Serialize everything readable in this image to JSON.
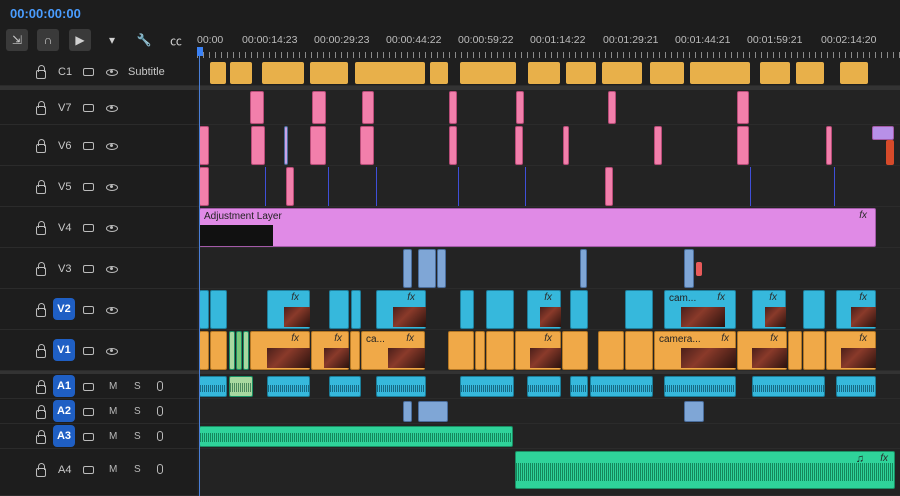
{
  "timecode": "00:00:00:00",
  "ruler": [
    "00:00",
    "00:00:14:23",
    "00:00:29:23",
    "00:00:44:22",
    "00:00:59:22",
    "00:01:14:22",
    "00:01:29:21",
    "00:01:44:21",
    "00:01:59:21",
    "00:02:14:20"
  ],
  "tools": [
    "insert-and-overwrite-icon",
    "snap-icon",
    "linked-selection-icon",
    "add-marker-icon",
    "settings-icon",
    "captions-icon"
  ],
  "tracks": {
    "c1": {
      "name": "C1",
      "label": "Subtitle"
    },
    "v7": {
      "name": "V7"
    },
    "v6": {
      "name": "V6"
    },
    "v5": {
      "name": "V5"
    },
    "v4": {
      "name": "V4"
    },
    "v3": {
      "name": "V3"
    },
    "v2": {
      "name": "V2"
    },
    "v1": {
      "name": "V1"
    },
    "a1": {
      "name": "A1"
    },
    "a2": {
      "name": "A2"
    },
    "a3": {
      "name": "A3"
    },
    "a4": {
      "name": "A4"
    }
  },
  "buttons": {
    "mute": "M",
    "solo": "S"
  },
  "clips": {
    "adjustment": "Adjustment Layer",
    "fx": "fx",
    "v1_ca": "ca...",
    "v1_camera": "camera...",
    "v2_cam": "cam..."
  },
  "colors": {
    "accent": "#4a9dff",
    "subtitle": "#e8b04a",
    "graphics": "#f27fab",
    "video_blue": "#36b8dc",
    "video_orange": "#f0a948",
    "music": "#2fd39a",
    "adjustment": "#e08ae6"
  }
}
